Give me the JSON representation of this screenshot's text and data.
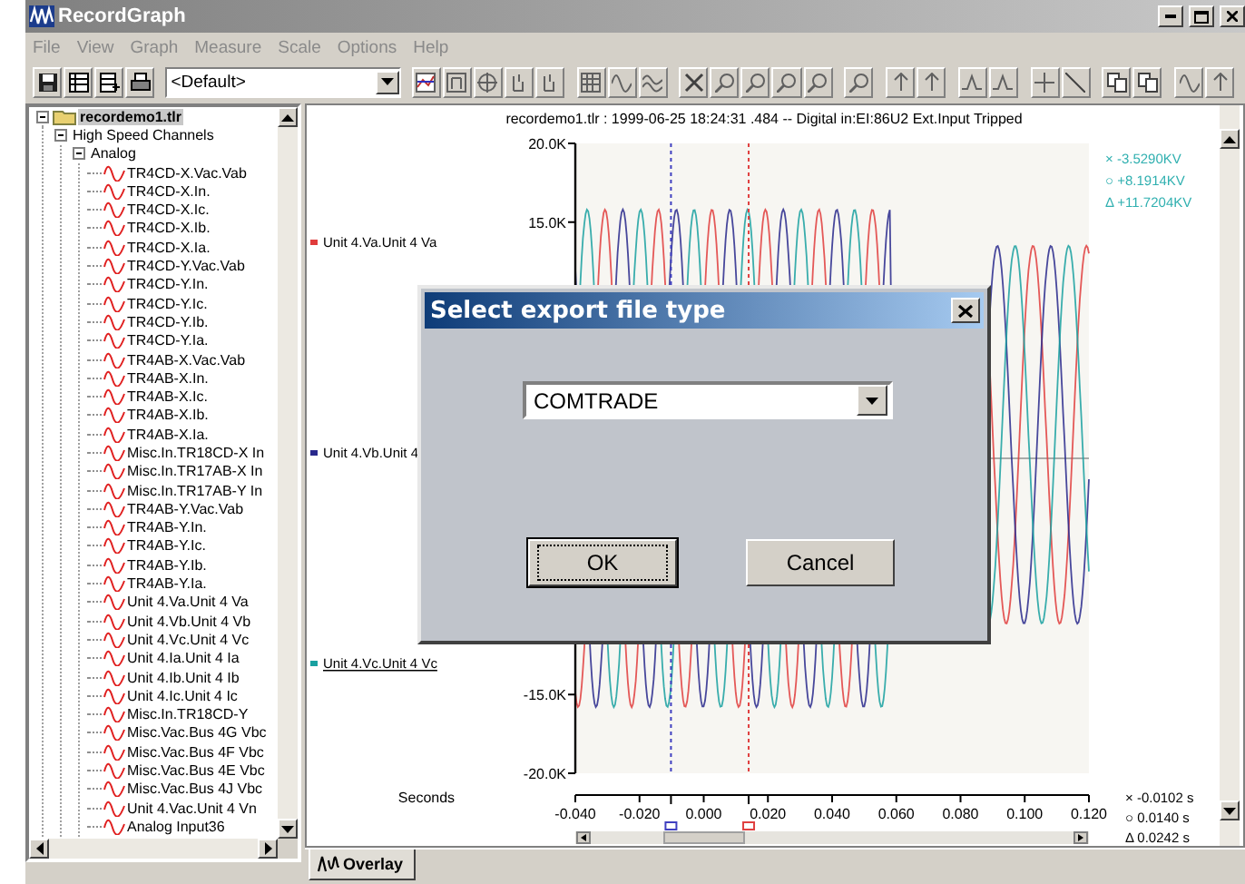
{
  "window": {
    "title": "RecordGraph"
  },
  "menu": [
    {
      "label": "File",
      "disabled": true
    },
    {
      "label": "View",
      "disabled": true
    },
    {
      "label": "Graph",
      "disabled": true
    },
    {
      "label": "Measure",
      "disabled": true
    },
    {
      "label": "Scale",
      "disabled": true
    },
    {
      "label": "Options",
      "disabled": true
    },
    {
      "label": "Help",
      "disabled": true
    }
  ],
  "toolbar": {
    "preset": "<Default>"
  },
  "tree": {
    "label": "recordemo1.tlr",
    "expanded": true,
    "selected": true,
    "children": [
      {
        "label": "High Speed Channels",
        "expanded": true,
        "selected": false,
        "children": [
          {
            "label": "Analog",
            "expanded": true,
            "selected": false,
            "children": [
              {
                "label": "TR4CD-X.Vac.Vab",
                "selected": false
              },
              {
                "label": "TR4CD-X.In.",
                "selected": false
              },
              {
                "label": "TR4CD-X.Ic.",
                "selected": false
              },
              {
                "label": "TR4CD-X.Ib.",
                "selected": false
              },
              {
                "label": "TR4CD-X.Ia.",
                "selected": false
              },
              {
                "label": "TR4CD-Y.Vac.Vab",
                "selected": false
              },
              {
                "label": "TR4CD-Y.In.",
                "selected": false
              },
              {
                "label": "TR4CD-Y.Ic.",
                "selected": false
              },
              {
                "label": "TR4CD-Y.Ib.",
                "selected": false
              },
              {
                "label": "TR4CD-Y.Ia.",
                "selected": false
              },
              {
                "label": "TR4AB-X.Vac.Vab",
                "selected": false
              },
              {
                "label": "TR4AB-X.In.",
                "selected": false
              },
              {
                "label": "TR4AB-X.Ic.",
                "selected": false
              },
              {
                "label": "TR4AB-X.Ib.",
                "selected": false
              },
              {
                "label": "TR4AB-X.Ia.",
                "selected": false
              },
              {
                "label": "Misc.In.TR18CD-X In",
                "selected": false
              },
              {
                "label": "Misc.In.TR17AB-X In",
                "selected": false
              },
              {
                "label": "Misc.In.TR17AB-Y In",
                "selected": false
              },
              {
                "label": "TR4AB-Y.Vac.Vab",
                "selected": false
              },
              {
                "label": "TR4AB-Y.In.",
                "selected": false
              },
              {
                "label": "TR4AB-Y.Ic.",
                "selected": false
              },
              {
                "label": "TR4AB-Y.Ib.",
                "selected": false
              },
              {
                "label": "TR4AB-Y.Ia.",
                "selected": false
              },
              {
                "label": "Unit 4.Va.Unit 4 Va",
                "selected": false
              },
              {
                "label": "Unit 4.Vb.Unit 4 Vb",
                "selected": false
              },
              {
                "label": "Unit 4.Vc.Unit 4 Vc",
                "selected": false
              },
              {
                "label": "Unit 4.Ia.Unit 4 Ia",
                "selected": false
              },
              {
                "label": "Unit 4.Ib.Unit 4 Ib",
                "selected": false
              },
              {
                "label": "Unit 4.Ic.Unit 4 Ic",
                "selected": false
              },
              {
                "label": "Misc.In.TR18CD-Y",
                "selected": false
              },
              {
                "label": "Misc.Vac.Bus 4G Vbc",
                "selected": false
              },
              {
                "label": "Misc.Vac.Bus 4F Vbc",
                "selected": false
              },
              {
                "label": "Misc.Vac.Bus 4E Vbc",
                "selected": false
              },
              {
                "label": "Misc.Vac.Bus 4J Vbc",
                "selected": false
              },
              {
                "label": "Unit 4.Vac.Unit 4 Vn",
                "selected": false
              },
              {
                "label": "Analog Input36",
                "selected": false
              }
            ]
          }
        ]
      }
    ]
  },
  "chart": {
    "title": "recordemo1.tlr : 1999-06-25 18:24:31 .484 -- Digital in:EI:86U2 Ext.Input Tripped",
    "legend": [
      {
        "label": "Unit 4.Va.Unit 4 Va",
        "color": "#e03c3c",
        "selected": false
      },
      {
        "label": "Unit 4.Vb.Unit 4",
        "color": "#28288c",
        "selected": false
      },
      {
        "label": "Unit 4.Vc.Unit 4 Vc",
        "color": "#18a0a0",
        "selected": true
      }
    ],
    "y_ticks": [
      "20.0K",
      "15.0K",
      "-15.0K",
      "-20.0K"
    ],
    "x_axis_label": "Seconds",
    "x_ticks": [
      "-0.040",
      "-0.020",
      "0.000",
      "0.020",
      "0.040",
      "0.060",
      "0.080",
      "0.100",
      "0.120"
    ],
    "value_readouts": [
      "× -3.5290KV",
      "○ +8.1914KV",
      "Δ +11.7204KV"
    ],
    "time_readouts": [
      "× -0.0102 s",
      "○ 0.0140 s",
      "Δ 0.0242 s"
    ]
  },
  "tabs": [
    {
      "label": "Overlay",
      "selected": true
    }
  ],
  "dialog": {
    "title": "Select export file type",
    "file_type": "COMTRADE",
    "buttons": [
      {
        "label": "OK",
        "default": true
      },
      {
        "label": "Cancel",
        "default": false
      }
    ]
  }
}
